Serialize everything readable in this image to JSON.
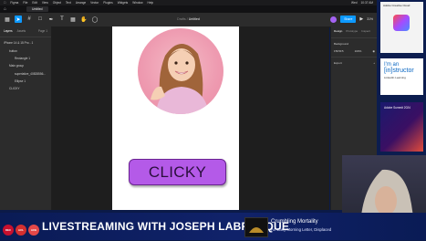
{
  "menubar": {
    "items": [
      "Figma",
      "File",
      "Edit",
      "View",
      "Object",
      "Text",
      "Arrange",
      "Vector",
      "Plugins",
      "Widgets",
      "Window",
      "Help"
    ],
    "right": [
      "Wed",
      "10:37 AM"
    ]
  },
  "tabs": {
    "file_tab": "Untitled"
  },
  "toolbar": {
    "title_prefix": "Drafts /",
    "title_file": "Untitled",
    "share_label": "Share",
    "zoom": "31%"
  },
  "layers_panel": {
    "tab_layers": "Layers",
    "tab_assets": "Assets",
    "page_label": "Page 1",
    "rows": [
      {
        "label": "iPhone 14 & 15 Pro - 1",
        "level": 0
      },
      {
        "label": "button",
        "level": 1
      },
      {
        "label": "Rectangle 1",
        "level": 2
      },
      {
        "label": "Main group",
        "level": 1
      },
      {
        "label": "superlative_40828556...",
        "level": 2
      },
      {
        "label": "Ellipse 1",
        "level": 2
      },
      {
        "label": "CLICKY",
        "level": 1
      }
    ]
  },
  "canvas": {
    "button_label": "CLICKY"
  },
  "design_panel": {
    "tab_design": "Design",
    "tab_prototype": "Prototype",
    "tab_inspect": "Inspect",
    "background_label": "Background",
    "background_value": "F5F5F5",
    "opacity": "100%",
    "export_label": "Export"
  },
  "ads": {
    "ad1_brand": "Adobe Creative Cloud",
    "ad2_line1": "I'm an",
    "ad2_line2": "[in]structor",
    "ad2_line3": "LinkedIn Learning",
    "ad3_text": "Adobe Summit 2024"
  },
  "banner": {
    "title": "LIVESTREAMING WITH JOSEPH LABRECQUE",
    "logos": [
      "DEC",
      "ACL",
      "ACE"
    ],
    "now_playing_title": "Crumbling Mortality",
    "now_playing_subtitle": "An Early Morning Letter, Displaced"
  },
  "colors": {
    "accent": "#0d99ff",
    "button_fill": "#b45ae8",
    "banner_bg": "#10226a"
  }
}
